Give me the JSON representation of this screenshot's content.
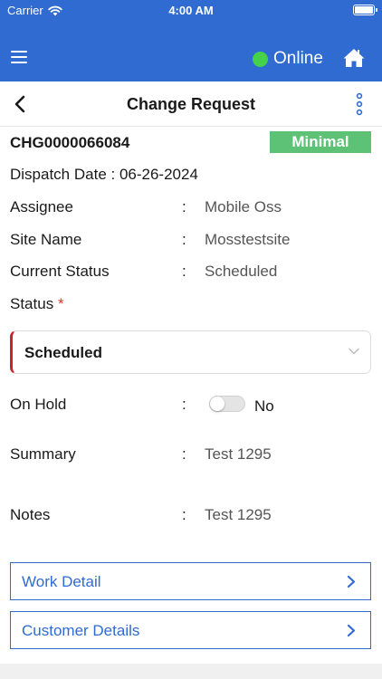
{
  "status_bar": {
    "carrier": "Carrier",
    "time": "4:00 AM",
    "battery_level": 1.0
  },
  "app_bar": {
    "connection_label": "Online",
    "connection_color": "#45d14a",
    "brand_color": "#2f6bd0"
  },
  "nav": {
    "title": "Change Request"
  },
  "record": {
    "id": "CHG0000066084",
    "priority": "Minimal",
    "dispatch_date": "Dispatch Date : 06-26-2024"
  },
  "fields": {
    "assignee": {
      "label": "Assignee",
      "value": "Mobile Oss"
    },
    "site_name": {
      "label": "Site Name",
      "value": "Mosstestsite"
    },
    "current_status": {
      "label": "Current Status",
      "value": "Scheduled"
    },
    "status": {
      "label": "Status",
      "required_mark": "*",
      "selected": "Scheduled"
    },
    "on_hold": {
      "label": "On Hold",
      "value": "No",
      "on": false
    },
    "summary": {
      "label": "Summary",
      "value": "Test 1295"
    },
    "notes": {
      "label": "Notes",
      "value": "Test 1295"
    }
  },
  "separator": ":",
  "links": {
    "work_detail": "Work Detail",
    "customer_details": "Customer Details"
  }
}
